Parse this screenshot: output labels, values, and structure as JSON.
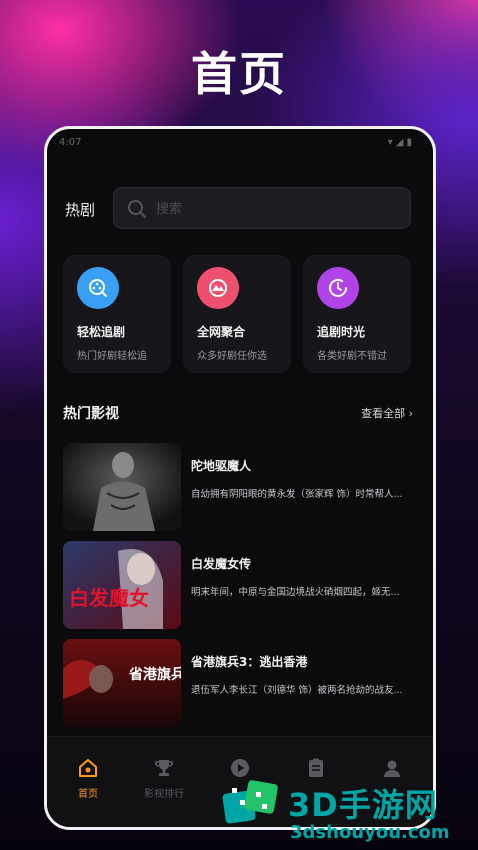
{
  "headline": "首页",
  "status_bar": {
    "time": "4:07",
    "icons": [
      "wifi-icon",
      "signal-icon",
      "battery-icon"
    ]
  },
  "topbar": {
    "title": "热剧",
    "search_placeholder": "搜索"
  },
  "features": [
    {
      "title": "轻松追剧",
      "desc": "热门好剧轻松追",
      "icon": "chase-icon",
      "color": "#3aa0f5"
    },
    {
      "title": "全网聚合",
      "desc": "众多好剧任你选",
      "icon": "aggregate-icon",
      "color": "#f0506e"
    },
    {
      "title": "追剧时光",
      "desc": "各类好剧不错过",
      "icon": "clock-icon",
      "color": "#b044e8"
    }
  ],
  "section": {
    "title": "热门影视",
    "more": "查看全部"
  },
  "movies": [
    {
      "title": "陀地驱魔人",
      "desc": "自幼拥有阴阳眼的黄永发（张家辉 饰）时常帮人..."
    },
    {
      "title": "白发魔女传",
      "desc": "明末年间，中原与金国边境战火硝烟四起，姬无..."
    },
    {
      "title": "省港旗兵3：逃出香港",
      "desc": "退伍军人李长江（刘德华 饰）被两名抢劫的战友..."
    }
  ],
  "poster_text": {
    "movie2_title_art": "白发魔女",
    "movie3_title_art": "省港旗兵"
  },
  "tabs": [
    {
      "label": "首页",
      "icon": "home-icon",
      "active": true
    },
    {
      "label": "影视排行",
      "icon": "trophy-icon",
      "active": false
    },
    {
      "label": "",
      "icon": "play-icon",
      "active": false
    },
    {
      "label": "",
      "icon": "list-icon",
      "active": false
    },
    {
      "label": "",
      "icon": "user-icon",
      "active": false
    }
  ],
  "watermark": {
    "brand": "3D手游网",
    "url": "3dshouyou.com"
  },
  "colors": {
    "accent": "#ff9a1f",
    "watermark": "#00a6a6"
  }
}
